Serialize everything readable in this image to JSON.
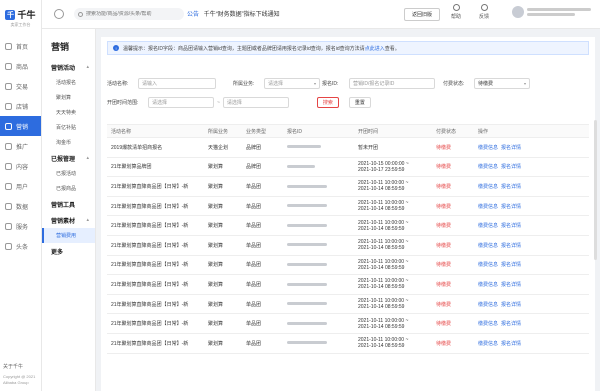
{
  "brand": {
    "name": "千牛",
    "subtitle": "卖家工作台"
  },
  "rail": {
    "items": [
      {
        "label": "首页",
        "icon": "home-icon"
      },
      {
        "label": "商品",
        "icon": "goods-icon"
      },
      {
        "label": "交易",
        "icon": "trade-icon"
      },
      {
        "label": "店铺",
        "icon": "shop-icon"
      },
      {
        "label": "营销",
        "icon": "marketing-icon"
      },
      {
        "label": "推广",
        "icon": "promotion-icon"
      },
      {
        "label": "内容",
        "icon": "content-icon"
      },
      {
        "label": "用户",
        "icon": "user-icon"
      },
      {
        "label": "数据",
        "icon": "data-icon"
      },
      {
        "label": "服务",
        "icon": "service-icon"
      },
      {
        "label": "头条",
        "icon": "news-icon"
      }
    ],
    "active_index": 4,
    "footer_about": "关于千牛",
    "footer_copy": "Copyright @ 2021 Alibaba Group"
  },
  "header": {
    "search_placeholder": "搜索功能/商品/资源/头条/帮助",
    "notice_tag": "公告",
    "notice_text": "千牛“财务数据”指标下线通知",
    "back_button": "返回旧版",
    "help_label": "帮助",
    "feedback_label": "反馈"
  },
  "subnav": {
    "title": "营销",
    "groups": [
      {
        "label": "营销活动",
        "items": [
          "活动报名",
          "聚划算",
          "天天特卖",
          "百亿补贴",
          "淘金币"
        ]
      },
      {
        "label": "已报管理",
        "items": [
          "已报活动",
          "已报商品"
        ]
      },
      {
        "label": "营销工具",
        "items": []
      },
      {
        "label": "营销素材",
        "items": [
          "营销费用"
        ]
      },
      {
        "label": "更多",
        "items": []
      }
    ],
    "active_item": "营销费用"
  },
  "tip": {
    "text": "温馨提示：报名ID字段：商品团请输入营销id查询，主题团或者品牌团请用报名记录id查询，报名id查询方法请",
    "link": "点此进入",
    "suffix": "查看。"
  },
  "filters": {
    "activity_name_label": "活动名称:",
    "activity_name_placeholder": "请输入",
    "business_label": "所属业务:",
    "business_placeholder": "请选择",
    "signup_id_label": "报名ID:",
    "signup_id_placeholder": "营销ID/报名记录ID",
    "pay_status_label": "付费状态:",
    "pay_status_value": "待缴费",
    "open_time_label": "开团时间范围:",
    "start_placeholder": "请选择",
    "end_placeholder": "请选择",
    "search_button": "搜索",
    "reset_button": "重置"
  },
  "table": {
    "columns": [
      "活动名称",
      "所属业务",
      "业务类型",
      "报名ID",
      "开团时间",
      "付费状态",
      "操作"
    ],
    "rows": [
      {
        "name": "2019爆款清单招商报名",
        "business": "天猫企划",
        "type": "品牌团",
        "id_w": 34,
        "time1": "暂未开团",
        "time2": "",
        "status": "待缴费",
        "op1": "缴费信息",
        "op2": "报名详情"
      },
      {
        "name": "21年聚划算品牌团",
        "business": "聚划算",
        "type": "品牌团",
        "id_w": 28,
        "time1": "2021-10-15 00:00:00 ~",
        "time2": "2021-10-17 23:59:59",
        "status": "待缴费",
        "op1": "缴费信息",
        "op2": "报名详情"
      },
      {
        "name": "21年聚划算直降商品团【日常】-新",
        "business": "聚划算",
        "type": "单品团",
        "id_w": 40,
        "time1": "2021-10-11 10:00:00 ~",
        "time2": "2021-10-14 08:59:59",
        "status": "待缴费",
        "op1": "缴费信息",
        "op2": "报名详情"
      },
      {
        "name": "21年聚划算直降商品团【日常】-新",
        "business": "聚划算",
        "type": "单品团",
        "id_w": 40,
        "time1": "2021-10-11 10:00:00 ~",
        "time2": "2021-10-14 08:59:59",
        "status": "待缴费",
        "op1": "缴费信息",
        "op2": "报名详情"
      },
      {
        "name": "21年聚划算直降商品团【日常】-新",
        "business": "聚划算",
        "type": "单品团",
        "id_w": 40,
        "time1": "2021-10-11 10:00:00 ~",
        "time2": "2021-10-14 08:59:59",
        "status": "待缴费",
        "op1": "缴费信息",
        "op2": "报名详情"
      },
      {
        "name": "21年聚划算直降商品团【日常】-新",
        "business": "聚划算",
        "type": "单品团",
        "id_w": 40,
        "time1": "2021-10-11 10:00:00 ~",
        "time2": "2021-10-14 08:59:59",
        "status": "待缴费",
        "op1": "缴费信息",
        "op2": "报名详情"
      },
      {
        "name": "21年聚划算直降商品团【日常】-新",
        "business": "聚划算",
        "type": "单品团",
        "id_w": 40,
        "time1": "2021-10-11 10:00:00 ~",
        "time2": "2021-10-14 08:59:59",
        "status": "待缴费",
        "op1": "缴费信息",
        "op2": "报名详情"
      },
      {
        "name": "21年聚划算直降商品团【日常】-新",
        "business": "聚划算",
        "type": "单品团",
        "id_w": 40,
        "time1": "2021-10-11 10:00:00 ~",
        "time2": "2021-10-14 08:59:59",
        "status": "待缴费",
        "op1": "缴费信息",
        "op2": "报名详情"
      },
      {
        "name": "21年聚划算直降商品团【日常】-新",
        "business": "聚划算",
        "type": "单品团",
        "id_w": 40,
        "time1": "2021-10-11 10:00:00 ~",
        "time2": "2021-10-14 08:59:59",
        "status": "待缴费",
        "op1": "缴费信息",
        "op2": "报名详情"
      },
      {
        "name": "21年聚划算直降商品团【日常】-新",
        "business": "聚划算",
        "type": "单品团",
        "id_w": 40,
        "time1": "2021-10-11 10:00:00 ~",
        "time2": "2021-10-14 08:59:59",
        "status": "待缴费",
        "op1": "缴费信息",
        "op2": "报名详情"
      },
      {
        "name": "21年聚划算直降商品团【日常】-新",
        "business": "聚划算",
        "type": "单品团",
        "id_w": 40,
        "time1": "2021-10-11 10:00:00 ~",
        "time2": "2021-10-14 08:59:59",
        "status": "待缴费",
        "op1": "缴费信息",
        "op2": "报名详情"
      }
    ]
  },
  "colors": {
    "accent": "#2d6cdf",
    "danger": "#e54545"
  }
}
